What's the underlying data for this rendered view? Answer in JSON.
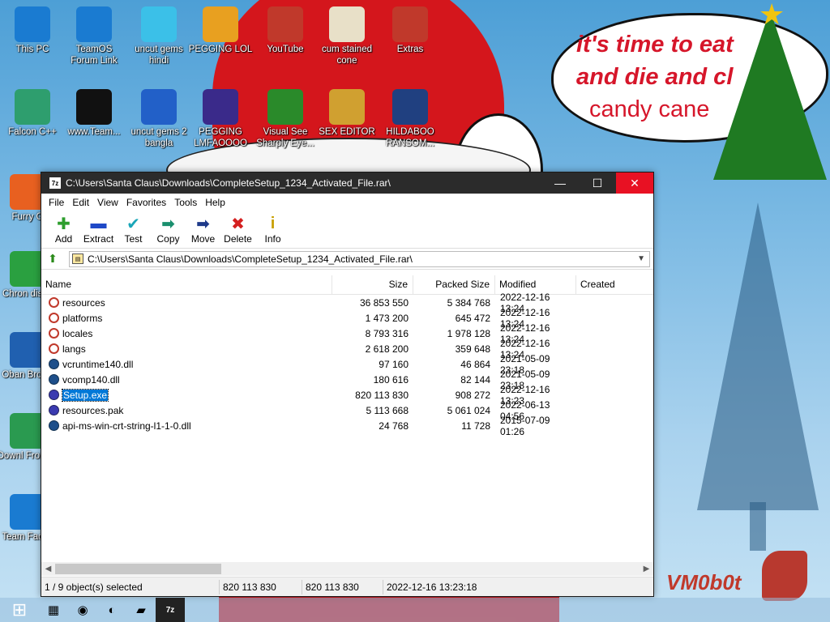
{
  "colors": {
    "titlebar": "#2b2b2b",
    "close": "#e81123",
    "selection": "#0078d7",
    "hat_red": "#d4161c"
  },
  "wallpaper": {
    "bubble_line1": "it's time to eat",
    "bubble_line2": "and die and cl",
    "bubble_line3": "candy cane",
    "signature": "VM0b0t"
  },
  "desktop_icons": [
    {
      "label": "This PC",
      "icon": "computer-icon"
    },
    {
      "label": "TeamOS Forum Link",
      "icon": "gear-icon"
    },
    {
      "label": "uncut gems hindi",
      "icon": "diamond-icon"
    },
    {
      "label": "PEGGING LOL",
      "icon": "p-logo-icon"
    },
    {
      "label": "YouTube",
      "icon": "angry-bird-icon"
    },
    {
      "label": "cum stained cone",
      "icon": "cone-icon"
    },
    {
      "label": "Extras",
      "icon": "photo-icon"
    },
    {
      "label": "Falcon C++",
      "icon": "recycle-icon"
    },
    {
      "label": "www.Team...",
      "icon": "book-icon"
    },
    {
      "label": "uncut gems 2 bangla",
      "icon": "diamond-2-icon"
    },
    {
      "label": "PEGGING LMFAOOOO",
      "icon": "orb-icon"
    },
    {
      "label": "Visual See Sharply Eye...",
      "icon": "csharp-icon"
    },
    {
      "label": "SEX EDITOR",
      "icon": "hxd-icon"
    },
    {
      "label": "HILDABOO RANSOM...",
      "icon": "script-icon"
    },
    {
      "label": "Furry G",
      "icon": "firefox-icon"
    },
    {
      "label": "Chron disea",
      "icon": "chrome-icon"
    },
    {
      "label": "Oban Brows",
      "icon": "obama-icon"
    },
    {
      "label": "Downl From te",
      "icon": "download-icon"
    },
    {
      "label": "Team Faceb",
      "icon": "gear-icon"
    }
  ],
  "window": {
    "title": "C:\\Users\\Santa Claus\\Downloads\\CompleteSetup_1234_Activated_File.rar\\",
    "app_icon": "7z",
    "menu": [
      "File",
      "Edit",
      "View",
      "Favorites",
      "Tools",
      "Help"
    ],
    "toolbar": [
      {
        "label": "Add",
        "icon": "add-icon",
        "glyph": "✚",
        "color": "#2e9e2e"
      },
      {
        "label": "Extract",
        "icon": "extract-icon",
        "glyph": "▬",
        "color": "#1f49c7"
      },
      {
        "label": "Test",
        "icon": "test-icon",
        "glyph": "✔",
        "color": "#1aa6b8"
      },
      {
        "label": "Copy",
        "icon": "copy-icon",
        "glyph": "➡",
        "color": "#1a8f6e"
      },
      {
        "label": "Move",
        "icon": "move-icon",
        "glyph": "➡",
        "color": "#1e3a8a"
      },
      {
        "label": "Delete",
        "icon": "delete-icon",
        "glyph": "✖",
        "color": "#d42020"
      },
      {
        "label": "Info",
        "icon": "info-icon",
        "glyph": "i",
        "color": "#c8a000"
      }
    ],
    "address": "C:\\Users\\Santa Claus\\Downloads\\CompleteSetup_1234_Activated_File.rar\\",
    "columns": [
      "Name",
      "Size",
      "Packed Size",
      "Modified",
      "Created"
    ],
    "files": [
      {
        "name": "resources",
        "size": "36 853 550",
        "packed": "5 384 768",
        "modified": "2022-12-16 13:24",
        "type": "folder",
        "selected": false
      },
      {
        "name": "platforms",
        "size": "1 473 200",
        "packed": "645 472",
        "modified": "2022-12-16 13:24",
        "type": "folder",
        "selected": false
      },
      {
        "name": "locales",
        "size": "8 793 316",
        "packed": "1 978 128",
        "modified": "2022-12-16 13:24",
        "type": "folder",
        "selected": false
      },
      {
        "name": "langs",
        "size": "2 618 200",
        "packed": "359 648",
        "modified": "2022-12-16 13:24",
        "type": "folder",
        "selected": false
      },
      {
        "name": "vcruntime140.dll",
        "size": "97 160",
        "packed": "46 864",
        "modified": "2021-05-09 23:18",
        "type": "dll",
        "selected": false
      },
      {
        "name": "vcomp140.dll",
        "size": "180 616",
        "packed": "82 144",
        "modified": "2021-05-09 23:18",
        "type": "dll",
        "selected": false
      },
      {
        "name": "Setup.exe",
        "size": "820 113 830",
        "packed": "908 272",
        "modified": "2022-12-16 13:23",
        "type": "exe",
        "selected": true
      },
      {
        "name": "resources.pak",
        "size": "5 113 668",
        "packed": "5 061 024",
        "modified": "2022-06-13 04:56",
        "type": "exe",
        "selected": false
      },
      {
        "name": "api-ms-win-crt-string-l1-1-0.dll",
        "size": "24 768",
        "packed": "11 728",
        "modified": "2015-07-09 01:26",
        "type": "dll",
        "selected": false
      }
    ],
    "status": {
      "selection": "1 / 9 object(s) selected",
      "size": "820 113 830",
      "packed": "820 113 830",
      "date": "2022-12-16 13:23:18"
    }
  },
  "taskbar": [
    {
      "icon": "windows-start-icon",
      "glyph": "⊞"
    },
    {
      "icon": "task-view-icon",
      "glyph": "▦"
    },
    {
      "icon": "chrome-icon",
      "glyph": "◉"
    },
    {
      "icon": "firefox-icon",
      "glyph": "◐"
    },
    {
      "icon": "file-explorer-icon",
      "glyph": "▰"
    },
    {
      "icon": "7zip-icon",
      "glyph": "7z"
    }
  ]
}
